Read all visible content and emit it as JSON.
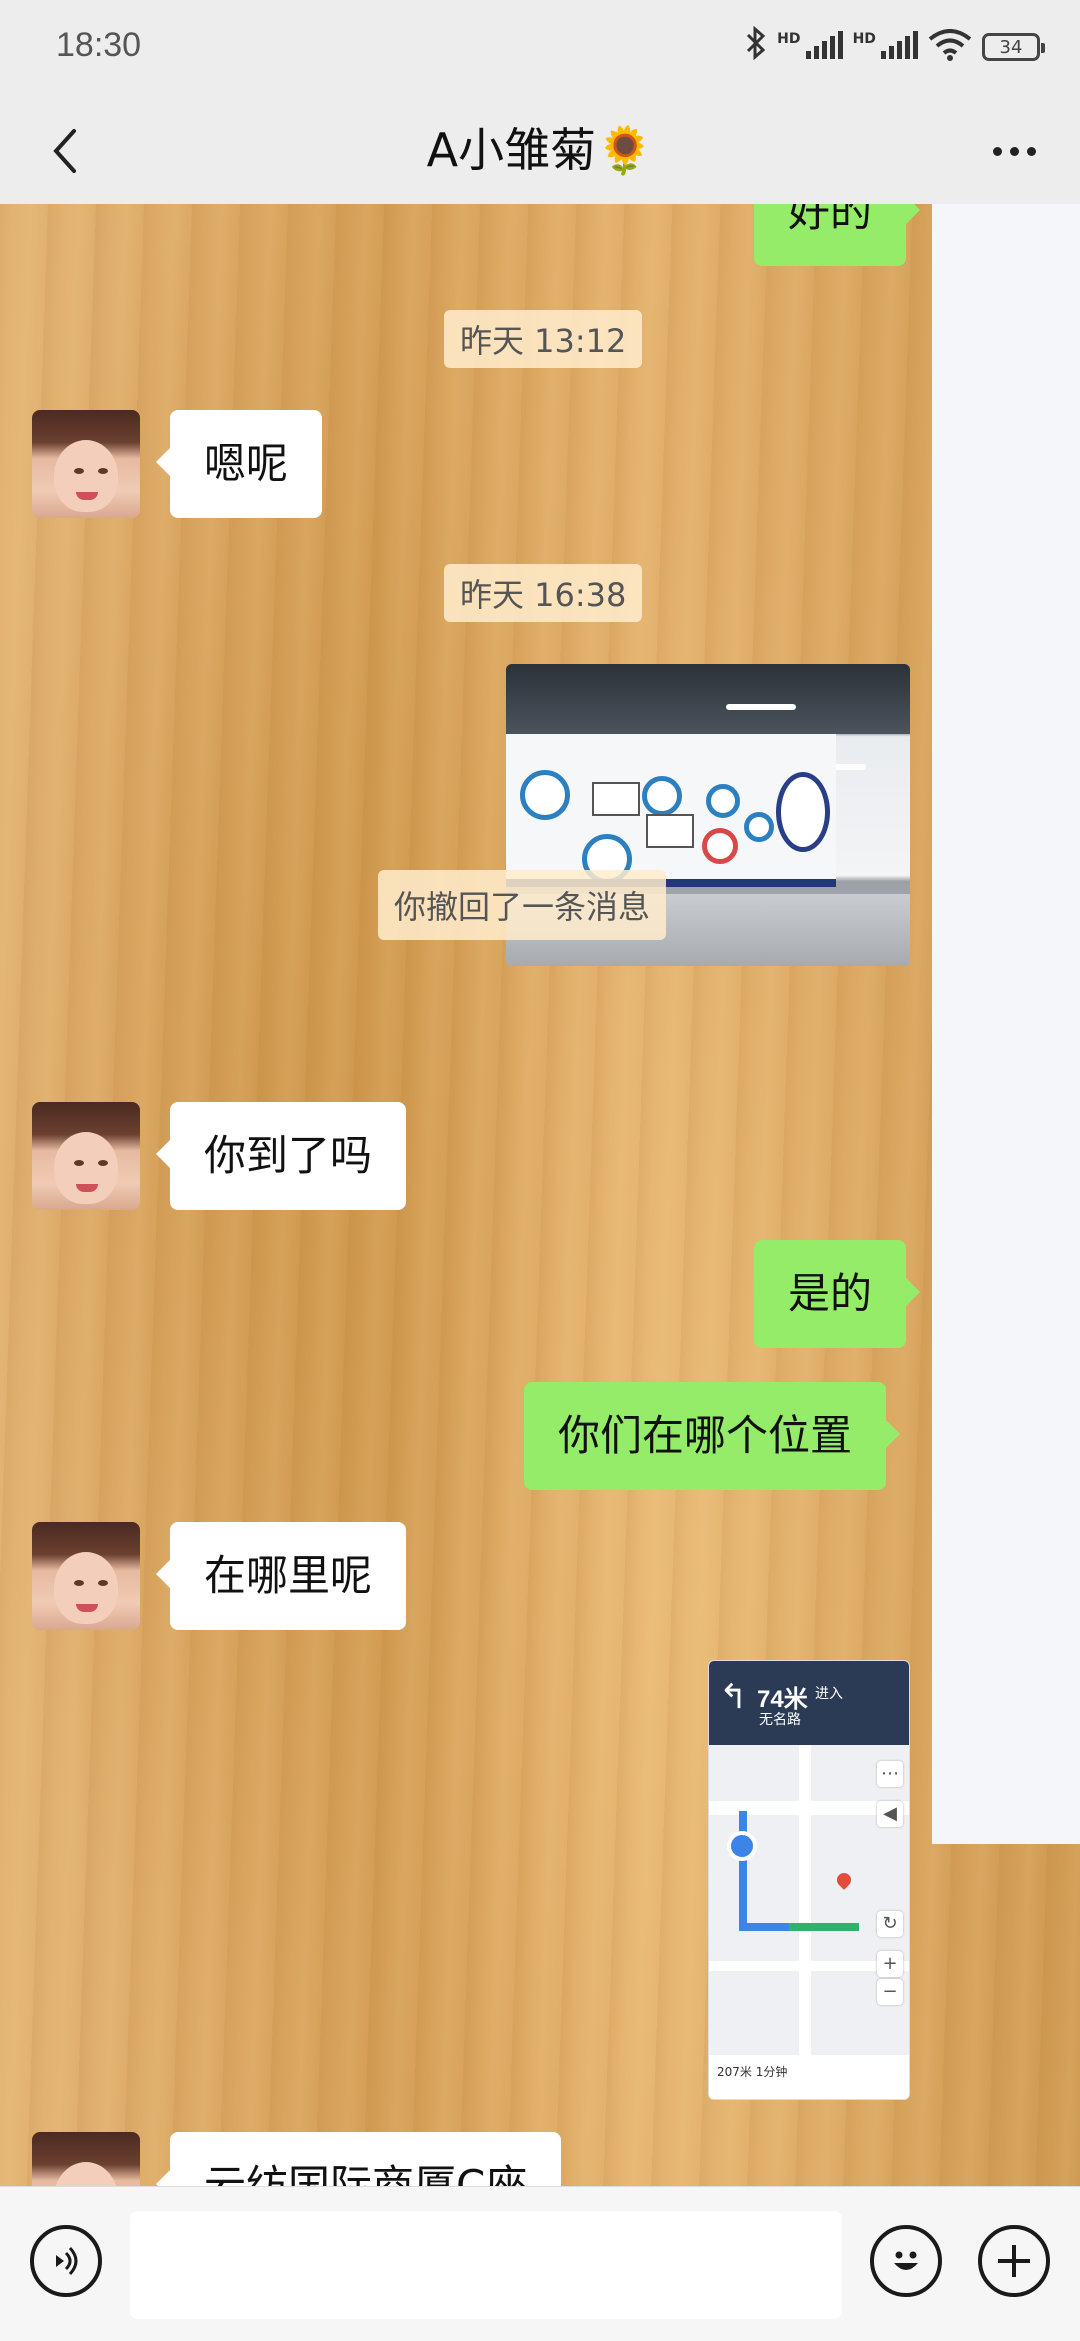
{
  "status_bar": {
    "time": "18:30",
    "battery": "34"
  },
  "header": {
    "title": "A小雏菊🌻"
  },
  "messages": {
    "m1": {
      "text": "好的"
    },
    "t1": {
      "text": "昨天 13:12"
    },
    "m2": {
      "text": "嗯呢"
    },
    "t2": {
      "text": "昨天 16:38"
    },
    "recall": {
      "text": "你撤回了一条消息"
    },
    "m4": {
      "text": "你到了吗"
    },
    "m5": {
      "text": "是的"
    },
    "m6": {
      "text": "你们在哪个位置"
    },
    "m7": {
      "text": "在哪里呢"
    },
    "m9": {
      "text": "云纺国际商厦C座"
    }
  },
  "map_shot": {
    "distance": "74米",
    "enter": "进入",
    "road": "无名路",
    "eta": "207米 1分钟"
  },
  "input": {
    "placeholder": ""
  },
  "icons": {
    "back": "back-arrow-icon",
    "more": "more-dots-icon",
    "voice": "voice-icon",
    "emoji": "emoji-icon",
    "plus": "plus-icon"
  }
}
